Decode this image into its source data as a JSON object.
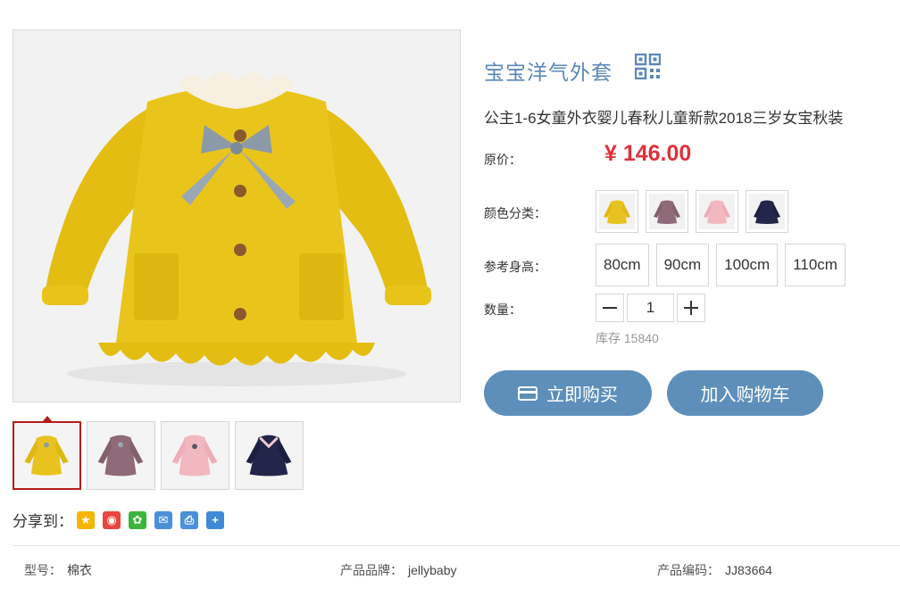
{
  "product": {
    "title": "宝宝洋气外套",
    "subtitle": "公主1-6女童外衣婴儿春秋儿童新款2018三岁女宝秋装"
  },
  "price": {
    "label": "原价：",
    "value": "¥ 146.00"
  },
  "color": {
    "label": "颜色分类：",
    "options": [
      {
        "name": "yellow-jacket",
        "color": "#e8c21e"
      },
      {
        "name": "mauve-jacket",
        "color": "#8f6a78"
      },
      {
        "name": "pink-jacket",
        "color": "#f2b8bf"
      },
      {
        "name": "navy-jacket",
        "color": "#22264a"
      }
    ]
  },
  "size": {
    "label": "参考身高：",
    "options": [
      "80cm",
      "90cm",
      "100cm",
      "110cm"
    ]
  },
  "quantity": {
    "label": "数量：",
    "value": "1",
    "stock": "库存 15840"
  },
  "actions": {
    "buy_now": "立即购买",
    "add_to_cart": "加入购物车"
  },
  "share": {
    "label": "分享到：",
    "icons": [
      "qzone-icon",
      "weibo-icon",
      "wechat-icon",
      "email-icon",
      "print-icon",
      "more-icon"
    ]
  },
  "details": {
    "model_label": "型号：",
    "model_value": "棉衣",
    "brand_label": "产品品牌：",
    "brand_value": "jellybaby",
    "code_label": "产品编码：",
    "code_value": "JJ83664"
  },
  "colors": {
    "accent": "#5d8fba",
    "title": "#5b88b7",
    "price": "#e0303b",
    "active_border": "#b41c1c"
  }
}
